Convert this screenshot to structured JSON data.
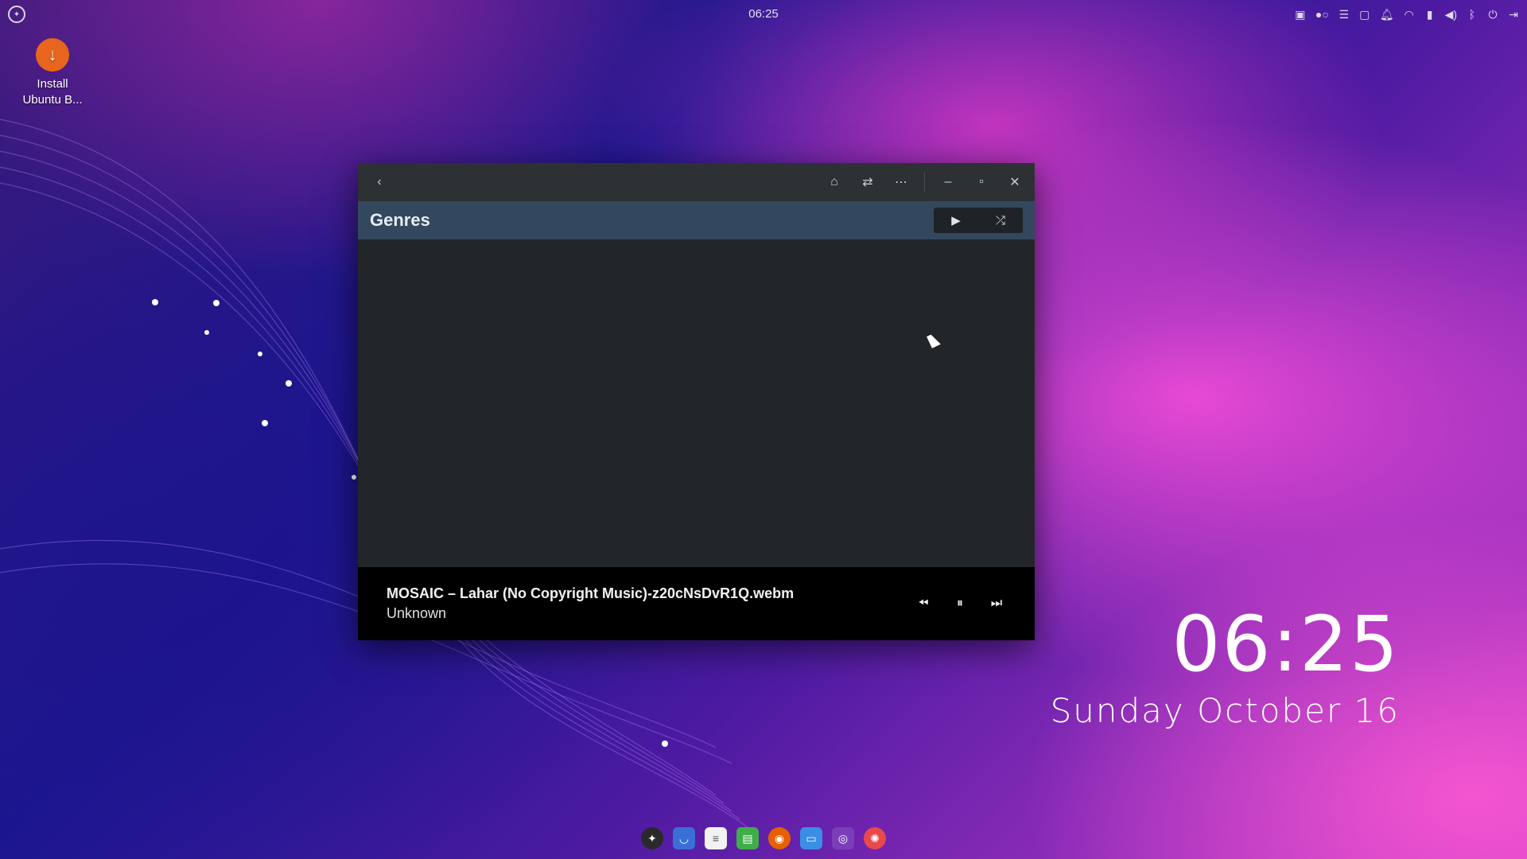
{
  "top_panel": {
    "clock": "06:25",
    "tray_icons": [
      "screen-icon",
      "toggle-icon",
      "menu-icon",
      "folder-icon",
      "bell-icon",
      "wifi-icon",
      "battery-icon",
      "volume-icon",
      "bluetooth-icon",
      "power-icon",
      "logout-icon"
    ]
  },
  "desktop": {
    "install_icon_label_line1": "Install",
    "install_icon_label_line2": "Ubuntu B..."
  },
  "window": {
    "header_title": "Genres",
    "titlebar_buttons": [
      "back-icon",
      "home-icon",
      "repeat-icon",
      "more-icon",
      "minimize-icon",
      "maximize-icon",
      "close-icon"
    ]
  },
  "player": {
    "track_name": "MOSAIC – Lahar (No Copyright Music)-z20cNsDvR1Q.webm",
    "artist": "Unknown"
  },
  "clock_widget": {
    "time": "06:25",
    "date": "Sunday October 16"
  },
  "dock": {
    "items": [
      "ubuntu-budgie-icon",
      "store-icon",
      "text-editor-icon",
      "spreadsheet-icon",
      "firefox-icon",
      "files-icon",
      "screencast-icon",
      "help-icon"
    ]
  },
  "colors": {
    "window_bg": "#232629",
    "titlebar_bg": "#2e3134",
    "headerbar_bg": "#33485e",
    "player_bg": "#000000",
    "install_icon": "#e8651d"
  }
}
